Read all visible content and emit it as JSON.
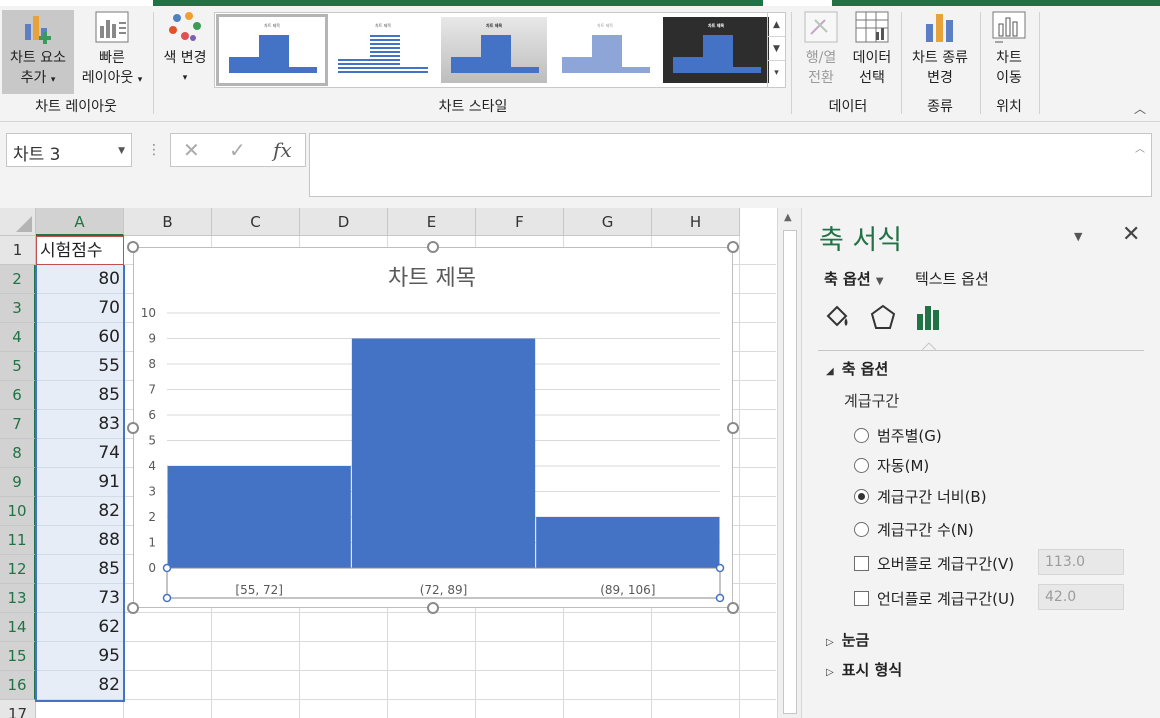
{
  "ribbon": {
    "add_chart_element": "차트 요소",
    "add_chart_element_2": "추가",
    "quick_layout": "빠른",
    "quick_layout_2": "레이아웃",
    "change_colors": "색 변경",
    "group_chart_layouts": "차트 레이아웃",
    "group_chart_styles": "차트 스타일",
    "switch_row_col": "행/열",
    "switch_row_col_2": "전환",
    "select_data": "데이터",
    "select_data_2": "선택",
    "group_data": "데이터",
    "change_chart_type": "차트 종류",
    "change_chart_type_2": "변경",
    "group_type": "종류",
    "move_chart": "차트",
    "move_chart_2": "이동",
    "group_location": "위치",
    "style_thumb_title": "차트 제목"
  },
  "formula_bar": {
    "name_box": "차트 3",
    "cancel": "✕",
    "enter": "✓",
    "fx": "fx",
    "value": ""
  },
  "sheet": {
    "columns": [
      "A",
      "B",
      "C",
      "D",
      "E",
      "F",
      "G",
      "H"
    ],
    "rows": [
      "1",
      "2",
      "3",
      "4",
      "5",
      "6",
      "7",
      "8",
      "9",
      "10",
      "11",
      "12",
      "13",
      "14",
      "15",
      "16",
      "17"
    ],
    "header_cell": "시험점수",
    "scores": [
      "80",
      "70",
      "60",
      "55",
      "85",
      "83",
      "74",
      "91",
      "82",
      "88",
      "85",
      "73",
      "62",
      "95",
      "82"
    ]
  },
  "chart_data": {
    "type": "bar",
    "title": "차트 제목",
    "categories": [
      "[55, 72]",
      "(72, 89]",
      "(89, 106]"
    ],
    "values": [
      4,
      9,
      2
    ],
    "ylim": [
      0,
      10
    ],
    "yticks": [
      "0",
      "1",
      "2",
      "3",
      "4",
      "5",
      "6",
      "7",
      "8",
      "9",
      "10"
    ],
    "bar_color": "#4472C4",
    "grid": true
  },
  "pane": {
    "title": "축 서식",
    "tab_axis_options": "축 옵션",
    "tab_text_options": "텍스트 옵션",
    "section_axis_options": "축 옵션",
    "bins_label": "계급구간",
    "opt_by_category": "범주별(G)",
    "opt_automatic": "자동(M)",
    "opt_bin_width": "계급구간 너비(B)",
    "opt_bin_count": "계급구간 수(N)",
    "overflow_bin": "오버플로 계급구간(V)",
    "overflow_value": "113.0",
    "underflow_bin": "언더플로 계급구간(U)",
    "underflow_value": "42.0",
    "section_tick_marks": "눈금",
    "section_number": "표시 형식",
    "accent_color": "#217346"
  }
}
